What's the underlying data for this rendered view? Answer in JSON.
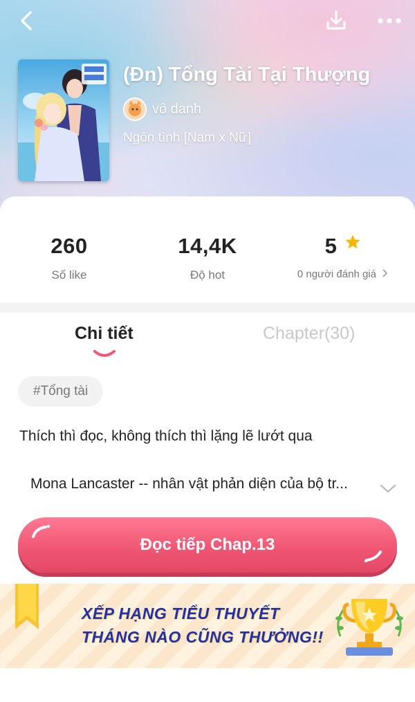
{
  "book": {
    "title": "(Đn) Tổng Tài Tại Thượng",
    "author": "vô danh",
    "genre": "Ngôn tình [Nam x Nữ]"
  },
  "stats": [
    {
      "value": "260",
      "label": "Số like"
    },
    {
      "value": "14,4K",
      "label": "Độ hot"
    },
    {
      "value": "5",
      "label": "0 người đánh giá",
      "icon": "star-icon"
    }
  ],
  "tabs": {
    "detail": "Chi tiết",
    "chapters": "Chapter(30)"
  },
  "tag": "#Tổng tài",
  "description": "Thích thì đọc,  không thích thì lặng lẽ lướt qua",
  "synopsis": "Mona Lancaster -- nhân vật phản diện của bộ tr...",
  "read_button": "Đọc tiếp Chap.13",
  "banner": {
    "line1": "XẾP HẠNG TIỂU THUYẾT",
    "line2": "THÁNG NÀO CŨNG THƯỞNG!!"
  },
  "colors": {
    "accent": "#f05774",
    "star": "#f5b800",
    "banner_text": "#1d2fb8"
  }
}
